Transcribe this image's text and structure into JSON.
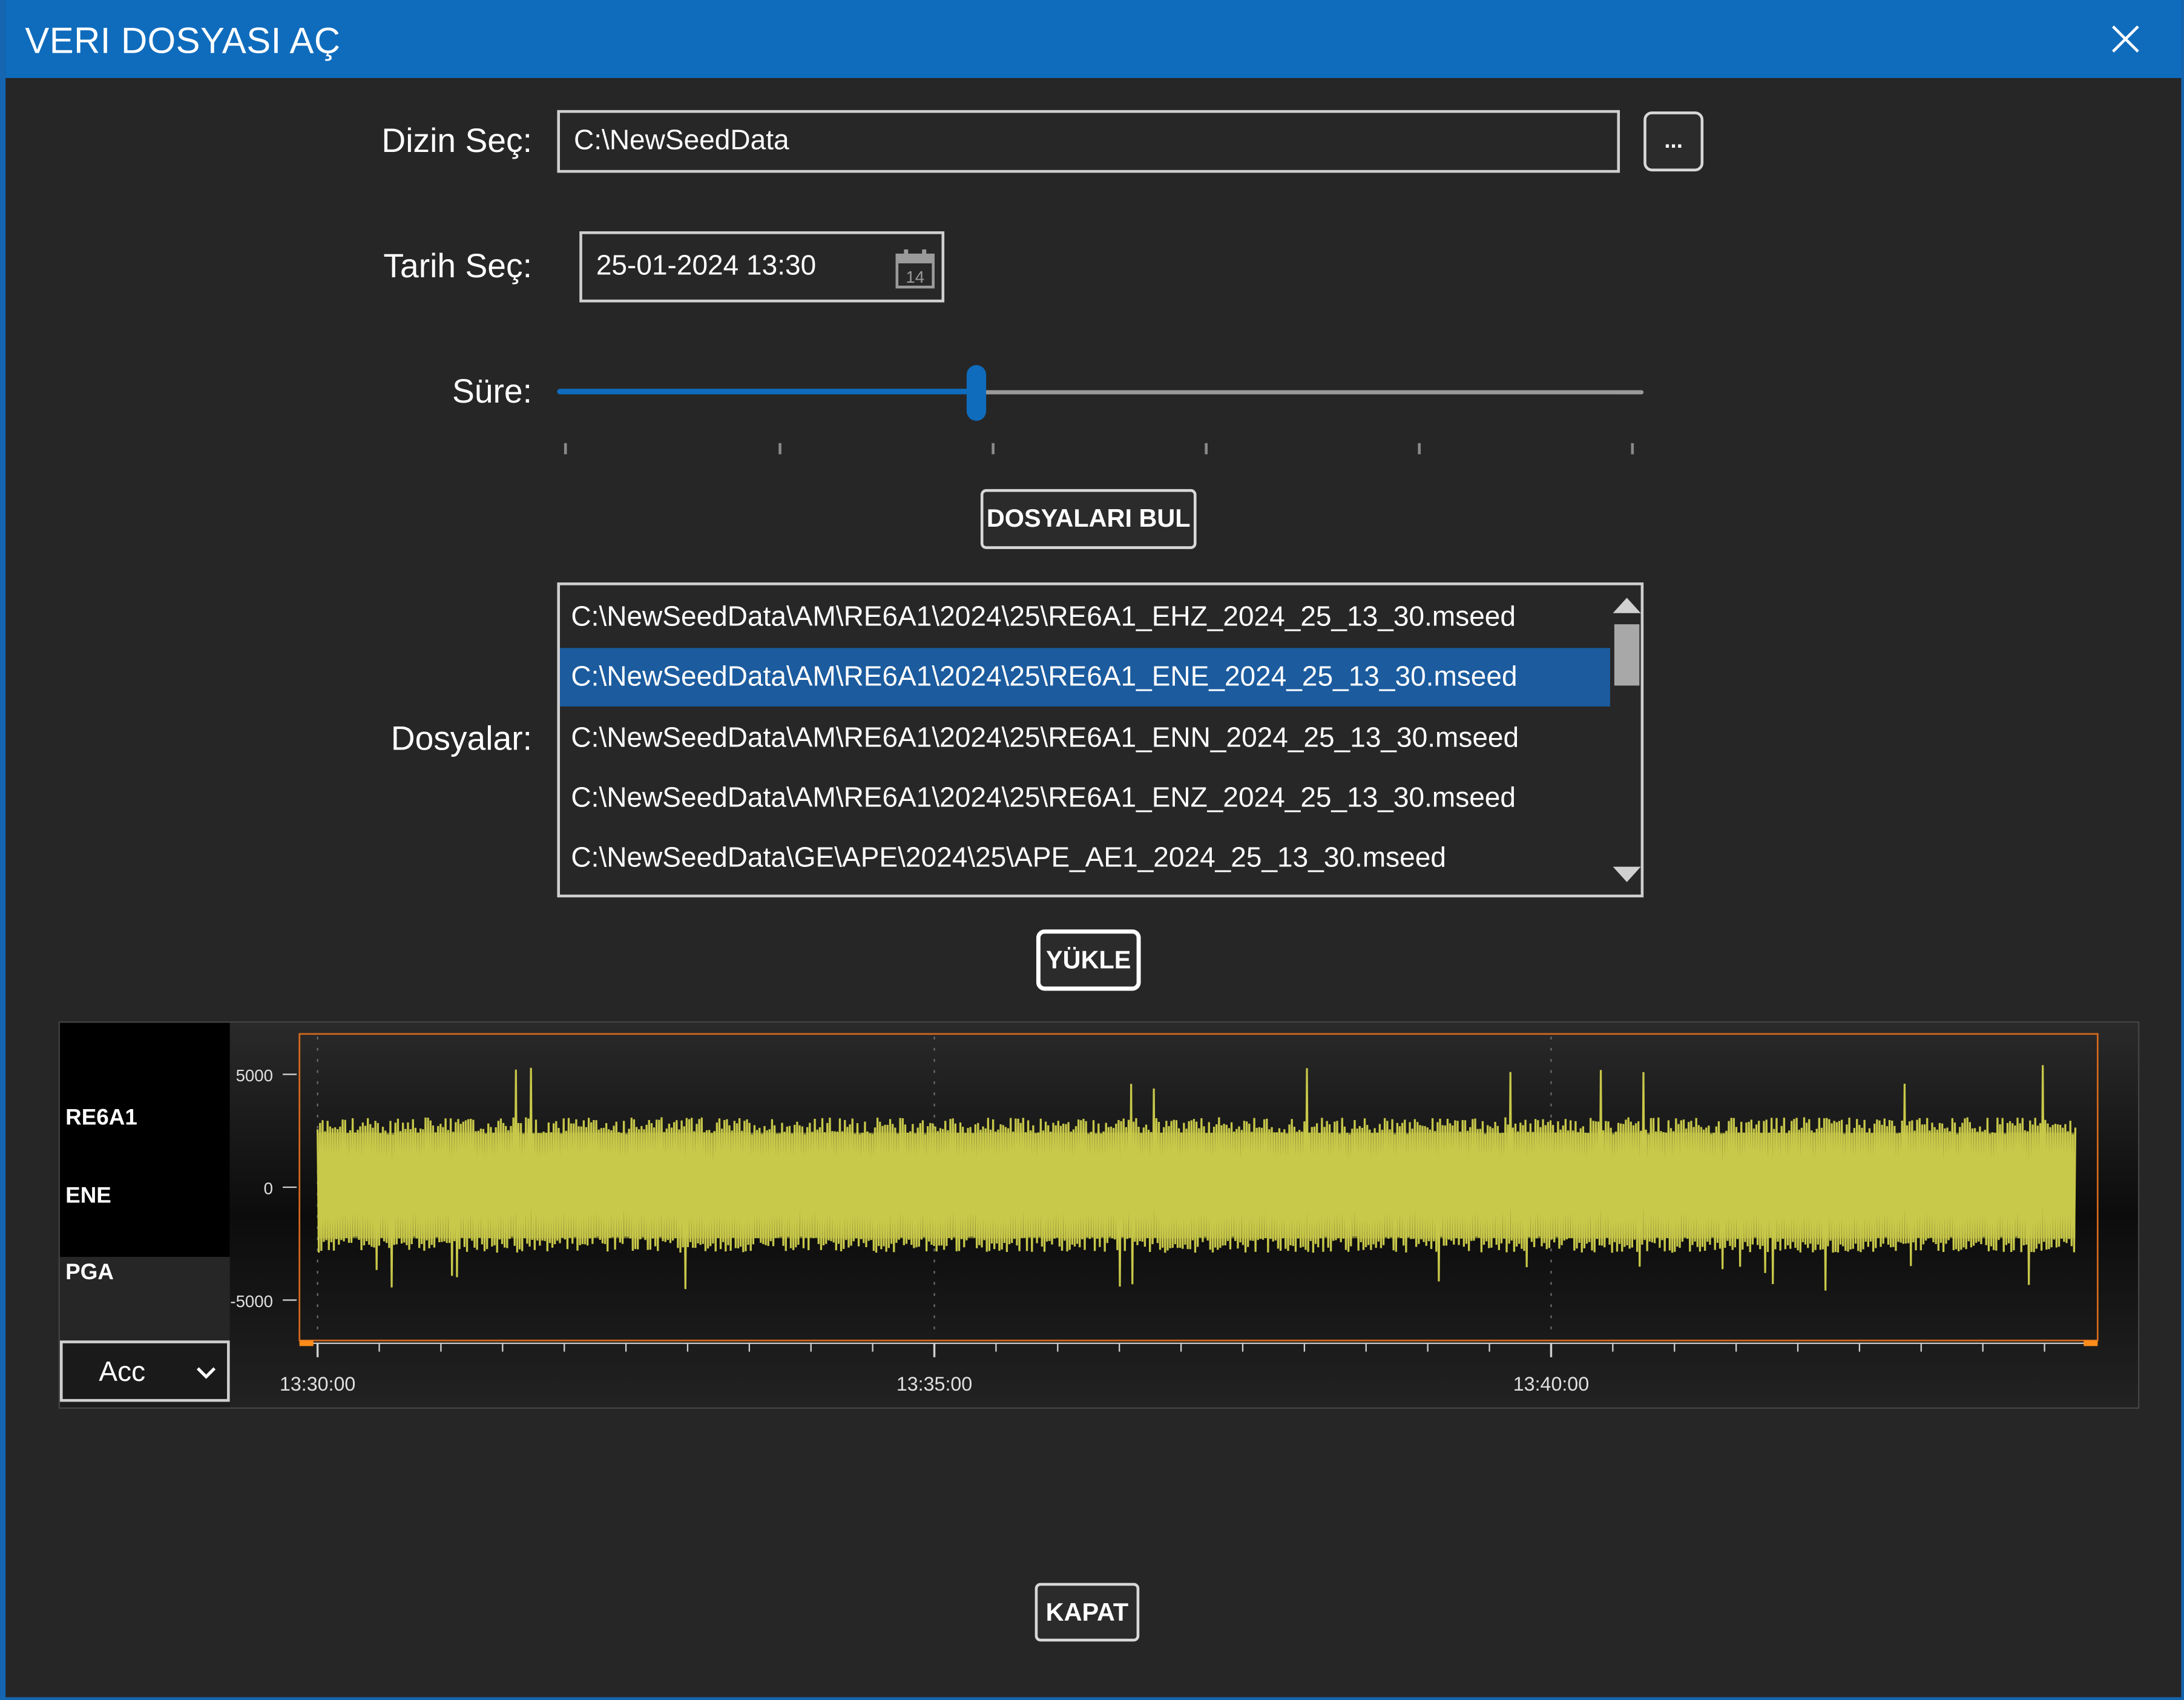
{
  "window": {
    "title": "VERI DOSYASI AÇ"
  },
  "labels": {
    "directory": "Dizin Seç:",
    "date": "Tarih Seç:",
    "duration": "Süre:",
    "files": "Dosyalar:"
  },
  "directory_input": {
    "value": "C:\\NewSeedData",
    "browse_label": "..."
  },
  "date_input": {
    "value": "25-01-2024 13:30",
    "calendar_day": "14"
  },
  "duration_slider": {
    "value": 2,
    "min": 0,
    "max": 5,
    "ticks": 6
  },
  "buttons": {
    "find_files": "DOSYALARI BUL",
    "load": "YÜKLE",
    "close": "KAPAT"
  },
  "files": [
    "C:\\NewSeedData\\AM\\RE6A1\\2024\\25\\RE6A1_EHZ_2024_25_13_30.mseed",
    "C:\\NewSeedData\\AM\\RE6A1\\2024\\25\\RE6A1_ENE_2024_25_13_30.mseed",
    "C:\\NewSeedData\\AM\\RE6A1\\2024\\25\\RE6A1_ENN_2024_25_13_30.mseed",
    "C:\\NewSeedData\\AM\\RE6A1\\2024\\25\\RE6A1_ENZ_2024_25_13_30.mseed",
    "C:\\NewSeedData\\GE\\APE\\2024\\25\\APE_AE1_2024_25_13_30.mseed"
  ],
  "selected_file_index": 1,
  "channel": {
    "station": "RE6A1",
    "component": "ENE",
    "pga_label": "PGA",
    "unit_select": "Acc"
  },
  "chart_data": {
    "type": "line",
    "title": "",
    "xlabel": "",
    "ylabel": "",
    "x_start": "13:30:00",
    "x_end": "13:44:15",
    "xticks": [
      "13:30:00",
      "13:35:00",
      "13:40:00"
    ],
    "yticks": [
      5000,
      0,
      -5000
    ],
    "ylim": [
      -6800,
      6800
    ],
    "series": [
      {
        "envelope_max": 3100,
        "envelope_min": -2900,
        "peak_max": 5600,
        "peak_min": -4600
      }
    ],
    "color": "#c8c84a",
    "grid": true
  },
  "colors": {
    "accent": "#0f6cbd",
    "selected": "#1b5b9e",
    "trace": "#c8c84a",
    "plot_border": "#d2691e"
  }
}
